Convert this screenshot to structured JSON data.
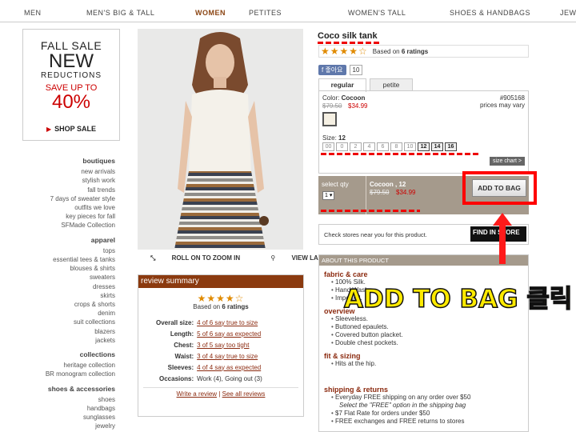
{
  "nav": [
    "MEN",
    "MEN'S BIG & TALL",
    "WOMEN",
    "PETITES",
    "WOMEN'S TALL",
    "SHOES & HANDBAGS",
    "JEW"
  ],
  "promo": {
    "l1": "FALL SALE",
    "l2": "NEW",
    "l3": "REDUCTIONS",
    "l4": "SAVE UP TO",
    "l5": "40%",
    "shop": "SHOP SALE"
  },
  "leftnav": [
    {
      "head": "boutiques",
      "items": [
        "new arrivals",
        "stylish work",
        "fall trends",
        "7 days of sweater style",
        "outfits we love",
        "key pieces for fall",
        "SFMade Collection"
      ]
    },
    {
      "head": "apparel",
      "items": [
        "tops",
        "essential tees & tanks",
        "blouses & shirts",
        "sweaters",
        "dresses",
        "skirts",
        "crops & shorts",
        "denim",
        "suit collections",
        "blazers",
        "jackets"
      ]
    },
    {
      "head": "collections",
      "items": [
        "heritage collection",
        "BR monogram collection"
      ]
    },
    {
      "head": "shoes & accessories",
      "items": [
        "shoes",
        "handbags",
        "sunglasses",
        "jewelry"
      ]
    }
  ],
  "zoom": {
    "roll": "ROLL ON TO ZOOM IN",
    "larger": "VIEW LARGER"
  },
  "review": {
    "header": "review summary",
    "based": "Based on",
    "count": "6 ratings",
    "rating": 4,
    "rows": [
      {
        "k": "Overall size:",
        "v": "4 of 6 say true to size"
      },
      {
        "k": "Length:",
        "v": "5 of 6 say as expected"
      },
      {
        "k": "Chest:",
        "v": "3 of 5 say too tight"
      },
      {
        "k": "Waist:",
        "v": "3 of 4 say true to size"
      },
      {
        "k": "Sleeves:",
        "v": "4 of 4 say as expected"
      },
      {
        "k": "Occasions:",
        "v": "Work (4), Going out (3)"
      }
    ],
    "write": "Write a review",
    "sep": "|",
    "all": "See all reviews"
  },
  "product": {
    "title": "Coco silk tank",
    "based": "Based on",
    "count": "6 ratings",
    "like": "f 좋아요",
    "likes": "10",
    "tabs": [
      "regular",
      "petite"
    ],
    "color_label": "Color:",
    "color": "Cocoon",
    "was": "$79.50",
    "now": "$34.99",
    "sku": "#905168",
    "sku_note": "prices may vary",
    "size_label": "Size:",
    "size": "12",
    "sizes": [
      "00",
      "0",
      "2",
      "4",
      "6",
      "8",
      "10",
      "12",
      "14",
      "16"
    ],
    "available": [
      "12",
      "14",
      "16"
    ],
    "size_chart": "size chart >",
    "qty_label": "select qty",
    "qty": "1 ▾",
    "item": "Cocoon , 12",
    "item_was": "$79.50",
    "item_now": "$34.99",
    "add": "ADD TO BAG",
    "check": "Check stores near you for this product.",
    "find": "FIND IN STORE"
  },
  "about": {
    "header": "ABOUT THIS PRODUCT",
    "fabric_t": "fabric & care",
    "fabric": [
      "100% Silk.",
      "Hand Wash.",
      "Imported."
    ],
    "overview_t": "overview",
    "overview": [
      "Sleeveless.",
      "Buttoned epaulets.",
      "Covered button placket.",
      "Double chest pockets."
    ],
    "fit_t": "fit & sizing",
    "fit": [
      "Hits at the hip."
    ],
    "ship_t": "shipping & returns",
    "ship1": "Everyday FREE shipping on any order over $50",
    "ship1note": "Select the \"FREE\" option in the shipping bag",
    "ship2": "$7 Flat Rate for orders under $50",
    "ship3": "FREE exchanges and FREE returns to stores"
  },
  "annotation": "ADD TO BAG 클릭",
  "colors": {
    "accent": "#8b3a0f",
    "sale": "#cc0000",
    "highlight": "#ff0000",
    "annotation": "#ffea00"
  }
}
